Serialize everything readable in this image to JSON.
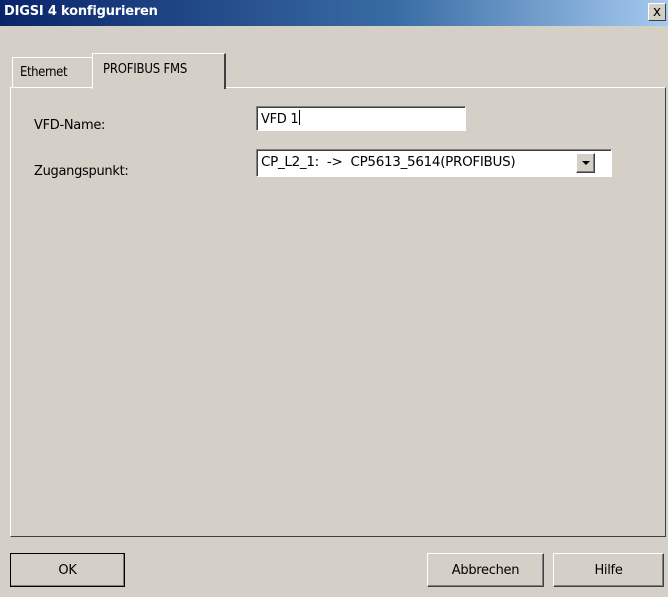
{
  "window": {
    "title": "DIGSI 4 konfigurieren",
    "close_glyph": "x",
    "titlebar_color": "#0a246a"
  },
  "tabs": [
    {
      "label": "Ethernet",
      "selected": false
    },
    {
      "label": "PROFIBUS FMS",
      "selected": true
    }
  ],
  "form": {
    "vfd_name_label": "VFD-Name:",
    "vfd_name_value": "VFD 1",
    "zugangspunkt_label": "Zugangspunkt:",
    "zugangspunkt_value": "CP_L2_1:  ->  CP5613_5614(PROFIBUS)",
    "dropdown_icon": "chevron-down-icon"
  },
  "buttons": {
    "ok": "OK",
    "abbrechen": "Abbrechen",
    "hilfe": "Hilfe"
  }
}
